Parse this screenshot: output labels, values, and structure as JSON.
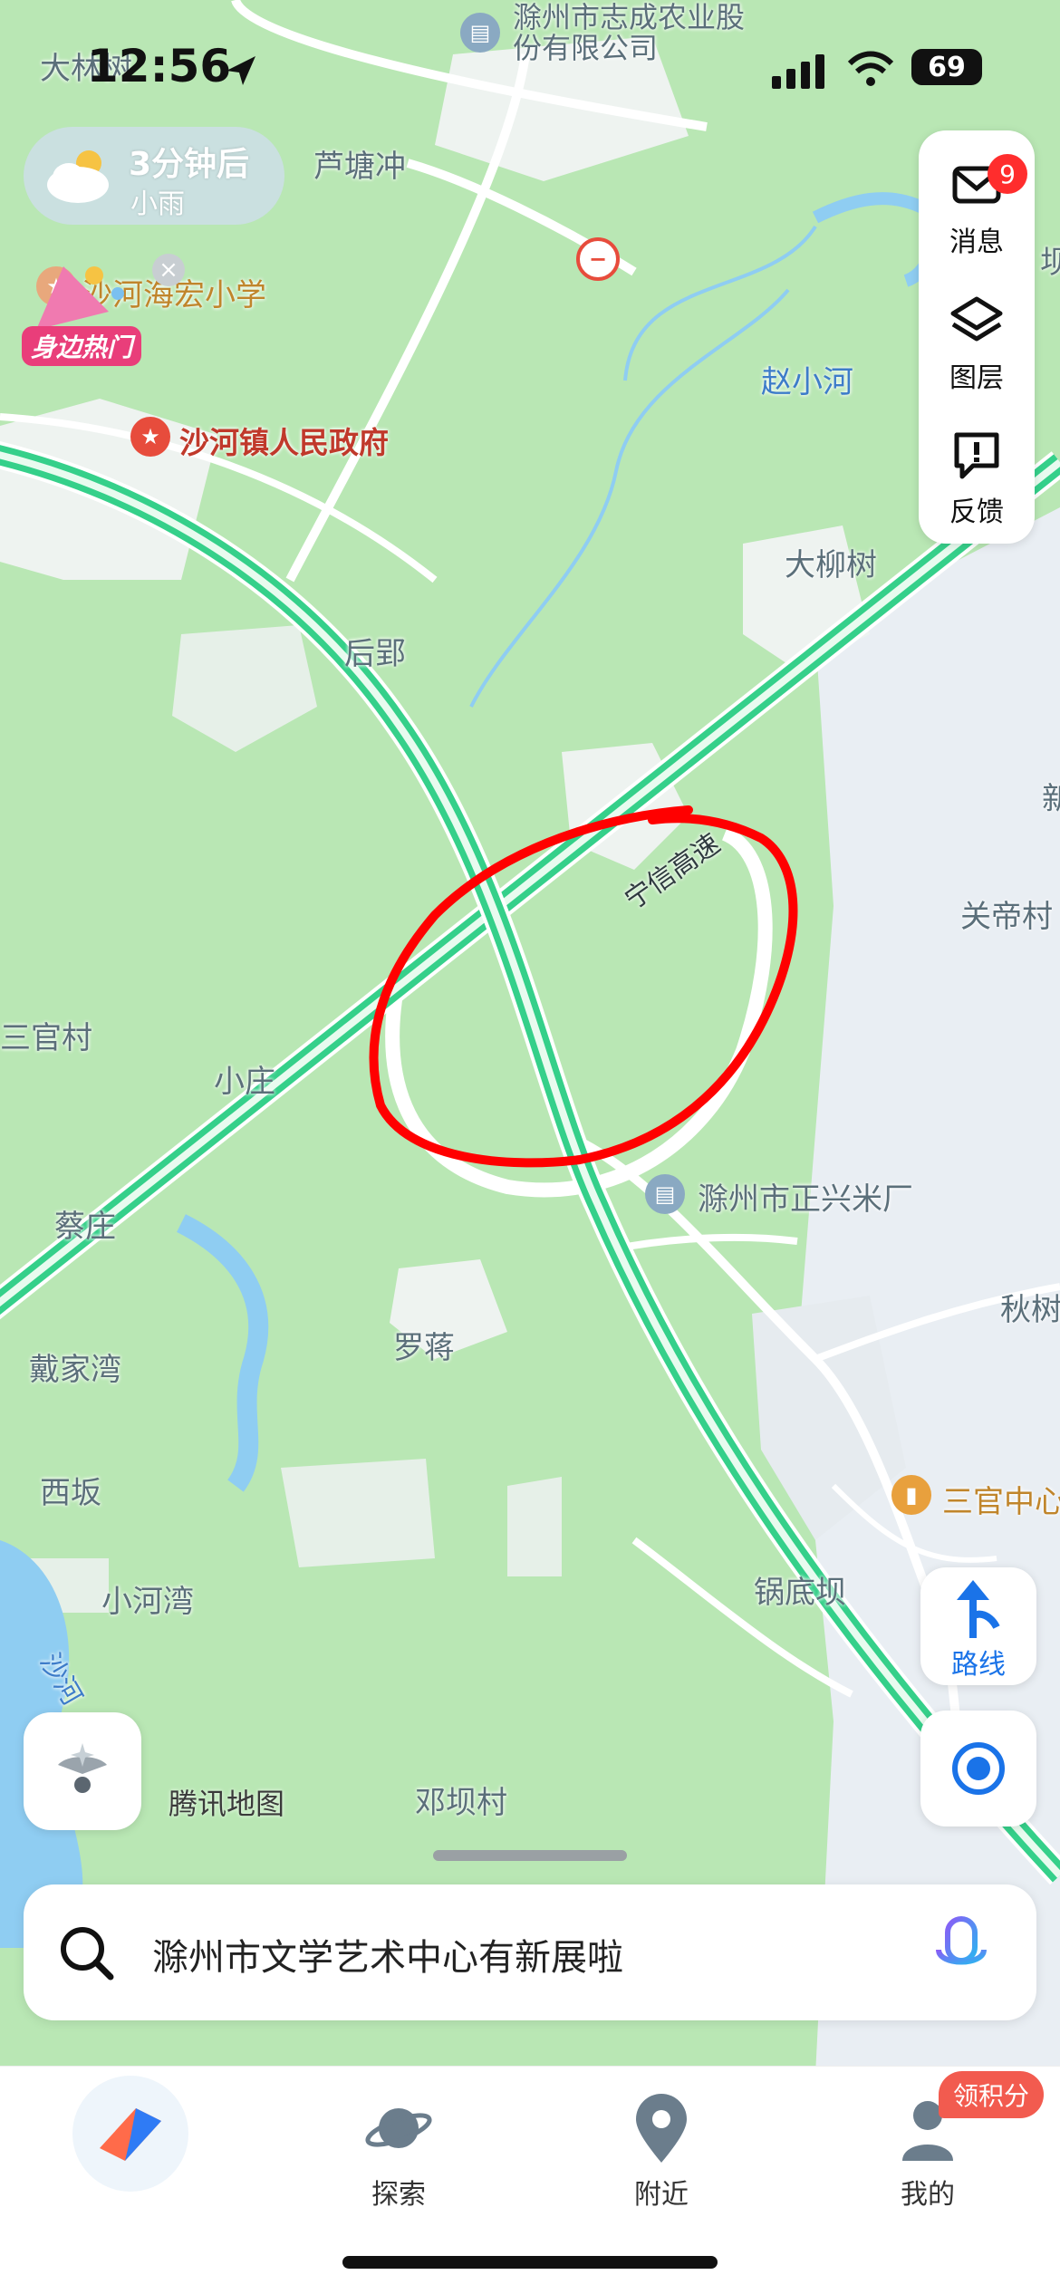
{
  "status_bar": {
    "time": "12:56",
    "battery": "69"
  },
  "weather": {
    "line1": "3分钟后",
    "line2": "小雨"
  },
  "hot_badge": "身边热门",
  "side_panel": {
    "messages": {
      "label": "消息",
      "badge": "9"
    },
    "layers": {
      "label": "图层"
    },
    "feedback": {
      "label": "反馈"
    }
  },
  "map": {
    "labels": {
      "dalinshu_top": "大林树",
      "company": "滁州市志成农业股份有限公司",
      "lutangchong": "芦塘冲",
      "school": "沙河海宏小学",
      "gov": "沙河镇人民政府",
      "zhaoxiaohe": "赵小河",
      "daliushu": "大柳树",
      "houying": "后郢",
      "expressway": "宁信高速",
      "guandicun": "关帝村",
      "sanguancun": "三官村",
      "xiaozhuang": "小庄",
      "caizhuang": "蔡庄",
      "ricemill": "滁州市正兴米厂",
      "dai": "戴家湾",
      "luojiang": "罗蒋",
      "xiban": "西坂",
      "qiu": "秋树",
      "sanguan_center": "三官中心",
      "xiaohewan": "小河湾",
      "guodiba": "锅底坝",
      "shahe": "沙河",
      "dengba": "邓坝村",
      "partial_bei": "坝",
      "partial_xin": "新"
    }
  },
  "map_logo": "腾讯地图",
  "route_button": "路线",
  "search": {
    "placeholder": "滁州市文学艺术中心有新展啦"
  },
  "tabs": [
    {
      "label": ""
    },
    {
      "label": "探索"
    },
    {
      "label": "附近"
    },
    {
      "label": "我的"
    }
  ],
  "points_badge": "领积分",
  "colors": {
    "map_green": "#b8e8b7",
    "road_green": "#35d08a",
    "annotation_red": "#ff0000",
    "accent_blue": "#1a73e8"
  }
}
